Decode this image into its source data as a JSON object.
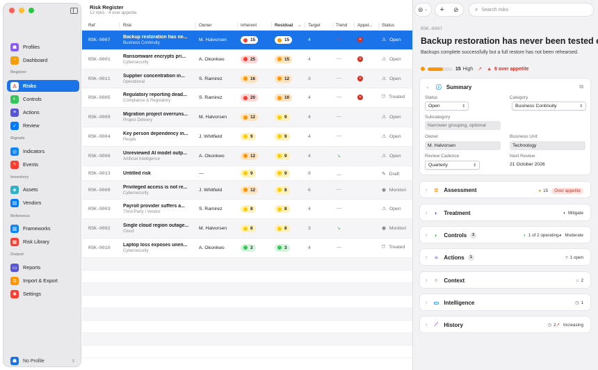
{
  "header": {
    "title": "Risk Register",
    "subtitle": "12 risks · 4 over appetite"
  },
  "sidebar": {
    "sections": [
      {
        "label": "",
        "items": [
          {
            "label": "Profiles",
            "icon": "person-icon",
            "color": "#8b5cf6"
          },
          {
            "label": "Dashboard",
            "icon": "gauge-icon",
            "color": "#f59e0b"
          }
        ]
      },
      {
        "label": "Register",
        "items": [
          {
            "label": "Risks",
            "icon": "warning-icon",
            "color": "#ffffff"
          },
          {
            "label": "Controls",
            "icon": "shield-icon",
            "color": "#34c759"
          },
          {
            "label": "Actions",
            "icon": "list-icon",
            "color": "#5856d6"
          },
          {
            "label": "Review",
            "icon": "check-icon",
            "color": "#007aff"
          }
        ]
      },
      {
        "label": "Signals",
        "items": [
          {
            "label": "Indicators",
            "icon": "target-icon",
            "color": "#0a84ff"
          },
          {
            "label": "Events",
            "icon": "bolt-icon",
            "color": "#ff3b30"
          }
        ]
      },
      {
        "label": "Inventory",
        "items": [
          {
            "label": "Assets",
            "icon": "cube-icon",
            "color": "#30b0c7"
          },
          {
            "label": "Vendors",
            "icon": "truck-icon",
            "color": "#007aff"
          }
        ]
      },
      {
        "label": "Reference",
        "items": [
          {
            "label": "Frameworks",
            "icon": "book-icon",
            "color": "#0a84ff"
          },
          {
            "label": "Risk Library",
            "icon": "books-icon",
            "color": "#ff3b30"
          }
        ]
      },
      {
        "label": "Output",
        "items": [
          {
            "label": "Reports",
            "icon": "doc-icon",
            "color": "#5856d6"
          },
          {
            "label": "Import & Export",
            "icon": "arrows-icon",
            "color": "#ff9500"
          },
          {
            "label": "Settings",
            "icon": "gear-icon",
            "color": "#ff3b30"
          }
        ]
      }
    ],
    "profile": "No Profile"
  },
  "table": {
    "columns": [
      "Ref",
      "Risk",
      "Owner",
      "Inherent",
      "Residual",
      "Target",
      "Trend",
      "Appet...",
      "Status"
    ],
    "rows": [
      {
        "ref": "RSK-0007",
        "title": "Backup restoration has ne...",
        "category": "Business Continuity",
        "owner": "M. Halvorsen",
        "inherent": "15",
        "inherent_color": "#ff3b30",
        "residual": "15",
        "residual_color": "#ff9500",
        "target": "4",
        "trend": "↗",
        "appetite": "over",
        "status": "Open",
        "status_icon": "warning-icon"
      },
      {
        "ref": "RSK-0001",
        "title": "Ransomware encrypts pri...",
        "category": "Cybersecurity",
        "owner": "A. Okonkwo",
        "inherent": "25",
        "inherent_color": "#ff3b30",
        "residual": "15",
        "residual_color": "#ff9500",
        "target": "4",
        "trend": "—",
        "appetite": "over",
        "status": "Open",
        "status_icon": "warning-icon"
      },
      {
        "ref": "RSK-0011",
        "title": "Supplier concentration in...",
        "category": "Operational",
        "owner": "S. Ramirez",
        "inherent": "16",
        "inherent_color": "#ff9500",
        "residual": "12",
        "residual_color": "#ff9500",
        "target": "3",
        "trend": "—",
        "appetite": "over",
        "status": "Open",
        "status_icon": "warning-icon"
      },
      {
        "ref": "RSK-0005",
        "title": "Regulatory reporting dead...",
        "category": "Compliance & Regulatory",
        "owner": "S. Ramirez",
        "inherent": "20",
        "inherent_color": "#ff3b30",
        "residual": "10",
        "residual_color": "#ff9500",
        "target": "4",
        "trend": "—",
        "appetite": "over",
        "status": "Treated",
        "status_icon": "check-shield-icon"
      },
      {
        "ref": "RSK-0009",
        "title": "Migration project overruns...",
        "category": "Project Delivery",
        "owner": "M. Halvorsen",
        "inherent": "12",
        "inherent_color": "#ff9500",
        "residual": "9",
        "residual_color": "#ffcc00",
        "target": "4",
        "trend": "—",
        "appetite": "",
        "status": "Open",
        "status_icon": "warning-icon"
      },
      {
        "ref": "RSK-0004",
        "title": "Key person dependency in...",
        "category": "People",
        "owner": "J. Whitfield",
        "inherent": "9",
        "inherent_color": "#ffcc00",
        "residual": "9",
        "residual_color": "#ffcc00",
        "target": "4",
        "trend": "—",
        "appetite": "",
        "status": "Open",
        "status_icon": "warning-icon"
      },
      {
        "ref": "RSK-0006",
        "title": "Unreviewed AI model outp...",
        "category": "Artificial Intelligence",
        "owner": "A. Okonkwo",
        "inherent": "12",
        "inherent_color": "#ff9500",
        "residual": "9",
        "residual_color": "#ffcc00",
        "target": "4",
        "trend": "↘",
        "appetite": "",
        "status": "Open",
        "status_icon": "warning-icon"
      },
      {
        "ref": "RSK-0013",
        "title": "Untitled risk",
        "category": "",
        "owner": "—",
        "inherent": "9",
        "inherent_color": "#ffcc00",
        "residual": "9",
        "residual_color": "#ffcc00",
        "target": "9",
        "trend": "—",
        "appetite": "",
        "status": "Draft",
        "status_icon": "pencil-icon"
      },
      {
        "ref": "RSK-0008",
        "title": "Privileged access is not re...",
        "category": "Cybersecurity",
        "owner": "J. Whitfield",
        "inherent": "12",
        "inherent_color": "#ff9500",
        "residual": "8",
        "residual_color": "#ffcc00",
        "target": "6",
        "trend": "—",
        "appetite": "",
        "status": "Monitori",
        "status_icon": "eye-icon"
      },
      {
        "ref": "RSK-0003",
        "title": "Payroll provider suffers a...",
        "category": "Third-Party / Vendor",
        "owner": "S. Ramirez",
        "inherent": "8",
        "inherent_color": "#ffcc00",
        "residual": "8",
        "residual_color": "#ffcc00",
        "target": "4",
        "trend": "—",
        "appetite": "",
        "status": "Open",
        "status_icon": "warning-icon"
      },
      {
        "ref": "RSK-0002",
        "title": "Single cloud region outage...",
        "category": "Cloud",
        "owner": "M. Halvorsen",
        "inherent": "8",
        "inherent_color": "#ffcc00",
        "residual": "8",
        "residual_color": "#ffcc00",
        "target": "3",
        "trend": "↘",
        "appetite": "",
        "status": "Monitori",
        "status_icon": "eye-icon"
      },
      {
        "ref": "RSK-0010",
        "title": "Laptop loss exposes unen...",
        "category": "Cybersecurity",
        "owner": "A. Okonkwo",
        "inherent": "3",
        "inherent_color": "#34c759",
        "residual": "3",
        "residual_color": "#34c759",
        "target": "4",
        "trend": "—",
        "appetite": "",
        "status": "Treated",
        "status_icon": "check-shield-icon"
      }
    ]
  },
  "search": {
    "placeholder": "Search risks"
  },
  "detail": {
    "ref": "RSK-0007",
    "title": "Backup restoration has never been tested en",
    "description": "Backups complete successfully but a full restore has not been rehearsed.",
    "score": "15",
    "score_label": "High",
    "over": "6 over appetite",
    "score_fraction": 0.6,
    "summary": {
      "title": "Summary",
      "status_label": "Status",
      "status": "Open",
      "category_label": "Category",
      "category": "Business Continuity",
      "subcategory_label": "Subcategory",
      "subcategory_placeholder": "Narrower grouping, optional",
      "owner_label": "Owner",
      "owner": "M. Halvorsen",
      "bu_label": "Business Unit",
      "bu": "Technology",
      "cadence_label": "Review Cadence",
      "cadence": "Quarterly",
      "next_label": "Next Review",
      "next": "21 October 2026"
    },
    "sections": [
      {
        "title": "Assessment",
        "icon": "sliders-icon",
        "icon_color": "#ff9500",
        "badge": "",
        "right": "15",
        "right2": "Over appetite"
      },
      {
        "title": "Treatment",
        "icon": "half-circle-icon",
        "icon_color": "#5856d6",
        "badge": "",
        "right": "Mitigate",
        "right2": ""
      },
      {
        "title": "Controls",
        "icon": "shield-icon",
        "icon_color": "#34c759",
        "badge": "2",
        "right": "1 of 2 operating",
        "right2": "Moderate"
      },
      {
        "title": "Actions",
        "icon": "list-icon",
        "icon_color": "#5856d6",
        "badge": "1",
        "right": "1 open",
        "right2": ""
      },
      {
        "title": "Context",
        "icon": "nodes-icon",
        "icon_color": "#8e8e93",
        "badge": "",
        "right": "2",
        "right2": ""
      },
      {
        "title": "Intelligence",
        "icon": "monitor-icon",
        "icon_color": "#0a84ff",
        "badge": "",
        "right": "1",
        "right2": ""
      },
      {
        "title": "History",
        "icon": "chart-icon",
        "icon_color": "#af52de",
        "badge": "",
        "right": "2",
        "right2": "Increasing"
      }
    ]
  }
}
